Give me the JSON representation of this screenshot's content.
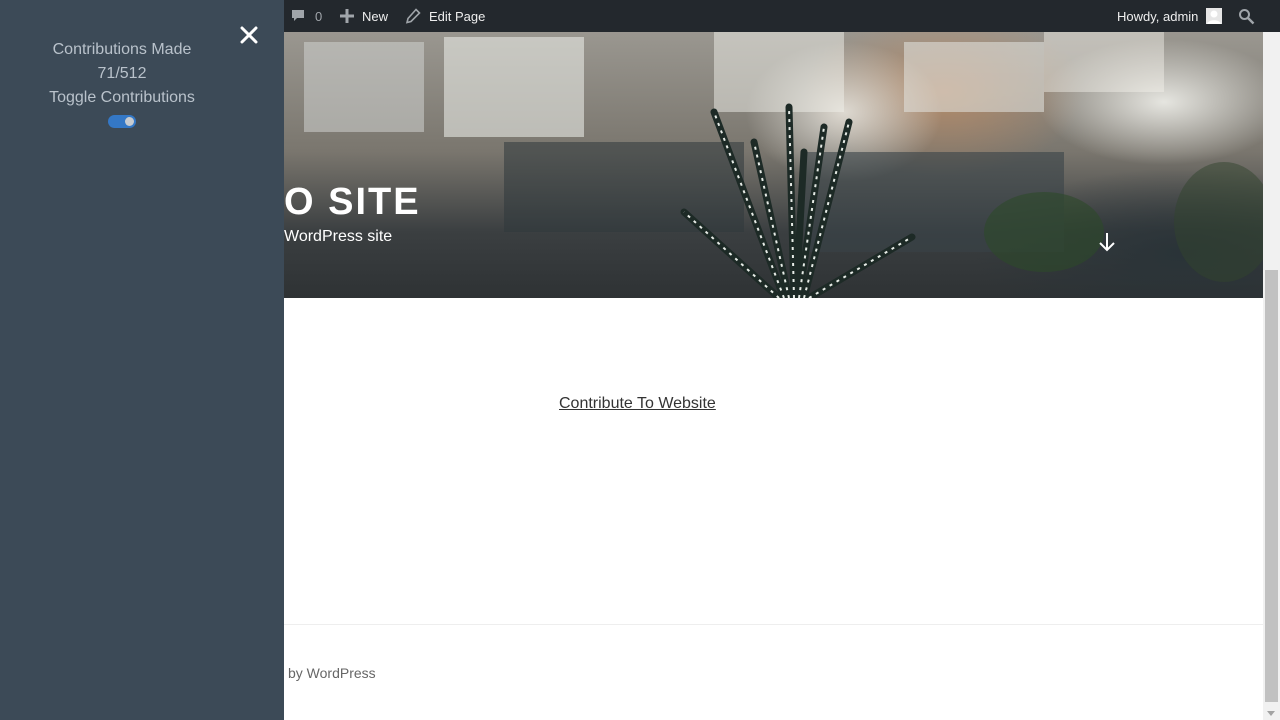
{
  "admin_bar": {
    "comments_count": "0",
    "new_label": "New",
    "edit_page_label": "Edit Page",
    "howdy_label": "Howdy, admin"
  },
  "header": {
    "site_title_visible": "O SITE",
    "site_description_visible": "WordPress site"
  },
  "content": {
    "contribute_link": "Contribute To Website"
  },
  "footer": {
    "powered_text_visible": "by WordPress"
  },
  "contributions_panel": {
    "title": "Contributions Made",
    "count": "71/512",
    "toggle_label": "Toggle Contributions",
    "toggle_on": true
  },
  "colors": {
    "panel_bg": "#3c4a57",
    "admin_bar_bg": "#23282d",
    "toggle_accent": "#3478c6"
  }
}
